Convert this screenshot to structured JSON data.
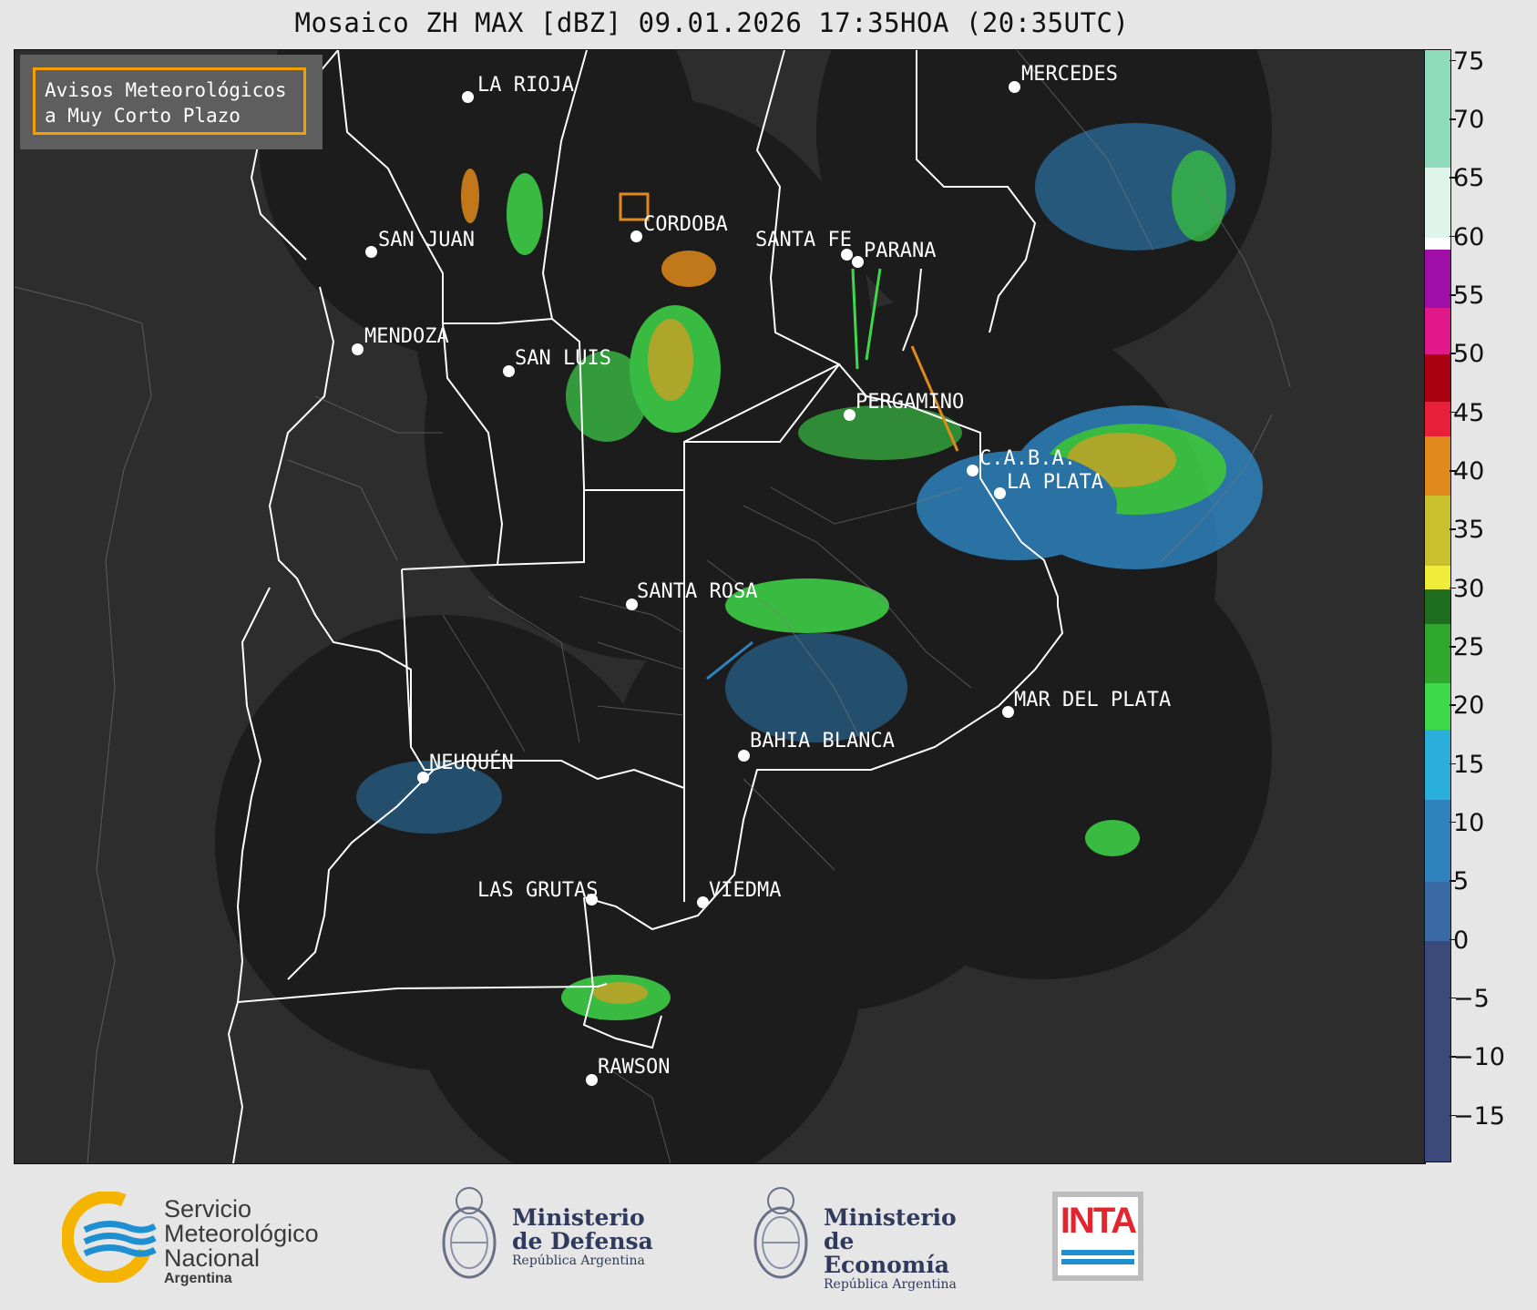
{
  "title": "Mosaico ZH MAX [dBZ] 09.01.2026 17:35HOA (20:35UTC)",
  "badge": {
    "line1": "Avisos Meteorológicos",
    "line2": "a Muy Corto Plazo",
    "border_color": "#f5a000"
  },
  "cities": [
    {
      "name": "LA RIOJA"
    },
    {
      "name": "SAN JUAN"
    },
    {
      "name": "CORDOBA"
    },
    {
      "name": "SANTA FE"
    },
    {
      "name": "PARANA"
    },
    {
      "name": "MENDOZA"
    },
    {
      "name": "SAN LUIS"
    },
    {
      "name": "PERGAMINO"
    },
    {
      "name": "C.A.B.A."
    },
    {
      "name": "LA PLATA"
    },
    {
      "name": "MERCEDES"
    },
    {
      "name": "SANTA ROSA"
    },
    {
      "name": "MAR DEL PLATA"
    },
    {
      "name": "BAHIA BLANCA"
    },
    {
      "name": "NEUQUÉN"
    },
    {
      "name": "LAS GRUTAS"
    },
    {
      "name": "VIEDMA"
    },
    {
      "name": "RAWSON"
    }
  ],
  "colorbar": {
    "ticks": [
      "75",
      "70",
      "65",
      "60",
      "55",
      "50",
      "45",
      "40",
      "35",
      "30",
      "25",
      "20",
      "15",
      "10",
      "5",
      "0",
      "−5",
      "−10",
      "−15"
    ],
    "min": -19,
    "max": 76,
    "bands": [
      {
        "from": -19,
        "to": 0,
        "color": "#3b4a7a"
      },
      {
        "from": 0,
        "to": 5,
        "color": "#3a6aa4"
      },
      {
        "from": 5,
        "to": 12,
        "color": "#2f82bd"
      },
      {
        "from": 12,
        "to": 18,
        "color": "#2aaedc"
      },
      {
        "from": 18,
        "to": 22,
        "color": "#3fd84a"
      },
      {
        "from": 22,
        "to": 27,
        "color": "#2fa82d"
      },
      {
        "from": 27,
        "to": 30,
        "color": "#1e6e1e"
      },
      {
        "from": 30,
        "to": 32,
        "color": "#f0ec3a"
      },
      {
        "from": 32,
        "to": 38,
        "color": "#c9c02e"
      },
      {
        "from": 38,
        "to": 43,
        "color": "#e08a1c"
      },
      {
        "from": 43,
        "to": 46,
        "color": "#e8203a"
      },
      {
        "from": 46,
        "to": 50,
        "color": "#a80010"
      },
      {
        "from": 50,
        "to": 54,
        "color": "#e0188a"
      },
      {
        "from": 54,
        "to": 59,
        "color": "#a010a8"
      },
      {
        "from": 59,
        "to": 60,
        "color": "#ffffff"
      },
      {
        "from": 60,
        "to": 66,
        "color": "#dff5ec"
      },
      {
        "from": 66,
        "to": 76,
        "color": "#8fdcbc"
      }
    ]
  },
  "logos": {
    "smn": {
      "line1": "Servicio",
      "line2": "Meteorológico",
      "line3": "Nacional",
      "sub": "Argentina"
    },
    "defensa": {
      "line1": "Ministerio",
      "line2": "de Defensa",
      "sub": "República Argentina"
    },
    "economia": {
      "line1": "Ministerio",
      "line2": "de Economía",
      "sub": "República Argentina"
    },
    "inta": {
      "text": "INTA"
    }
  }
}
